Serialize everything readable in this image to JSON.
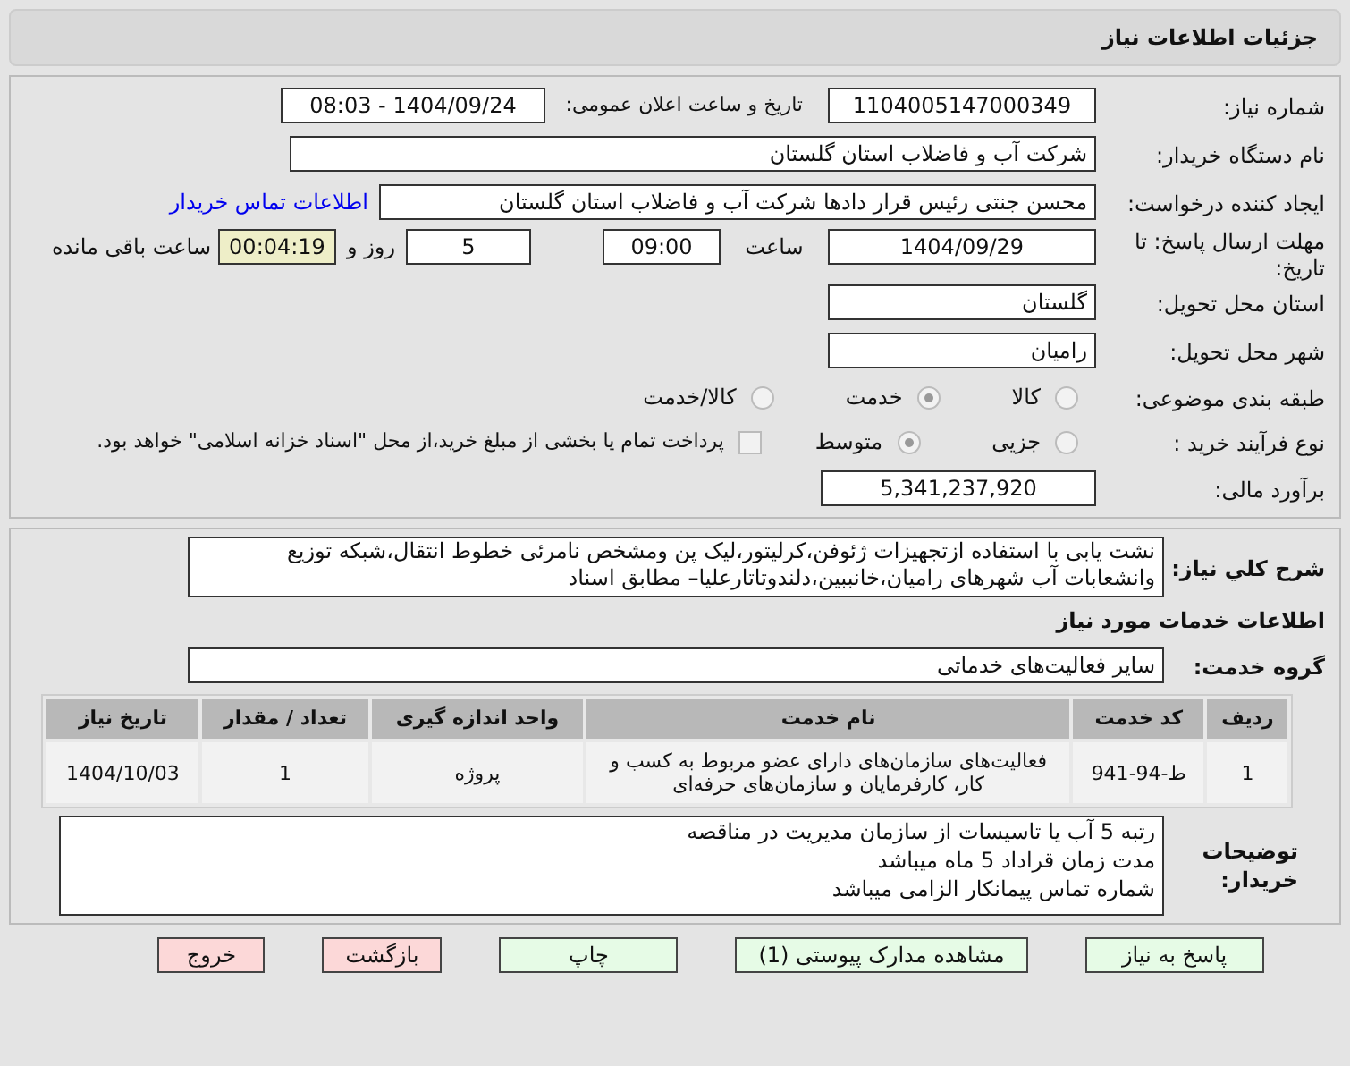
{
  "header": {
    "title": "جزئیات اطلاعات نیاز"
  },
  "need_number": {
    "label": "شماره نیاز:",
    "value": "1104005147000349"
  },
  "announce": {
    "label": "تاریخ و ساعت اعلان عمومی:",
    "value": "1404/09/24 - 08:03"
  },
  "buyer": {
    "label": "نام دستگاه خریدار:",
    "value": "شرکت آب و فاضلاب استان گلستان"
  },
  "creator": {
    "label": "ایجاد کننده درخواست:",
    "value": "محسن جنتی رئیس قرار دادها شرکت آب و فاضلاب استان گلستان",
    "link": "اطلاعات تماس خریدار"
  },
  "deadline": {
    "label": "مهلت ارسال پاسخ: تا تاریخ:",
    "date": "1404/09/29",
    "time_label": "ساعت",
    "time": "09:00",
    "days": "5",
    "days_label": "روز و",
    "remaining": "00:04:19",
    "remaining_label": "ساعت باقی مانده"
  },
  "province": {
    "label": "استان محل تحویل:",
    "value": "گلستان"
  },
  "city": {
    "label": "شهر محل تحویل:",
    "value": "رامیان"
  },
  "category": {
    "label": "طبقه بندی موضوعی:",
    "options": [
      {
        "label": "کالا",
        "selected": false
      },
      {
        "label": "خدمت",
        "selected": true
      },
      {
        "label": "کالا/خدمت",
        "selected": false
      }
    ]
  },
  "process": {
    "label": "نوع فرآیند خرید :",
    "options": [
      {
        "label": "جزیی",
        "selected": false
      },
      {
        "label": "متوسط",
        "selected": true
      }
    ],
    "payment_note": {
      "label": "پرداخت تمام یا بخشی از مبلغ خرید،از محل \"اسناد خزانه اسلامی\" خواهد بود.",
      "checked": false
    }
  },
  "budget": {
    "label": "برآورد مالی:",
    "value": "5,341,237,920"
  },
  "description": {
    "label": "شرح کلي نیاز:",
    "value": "نشت یابی با استفاده ازتجهیزات ژئوفن،کرلیتور،لیک پن ومشخص نامرئی خطوط انتقال،شبکه توزیع وانشعابات آب شهرهای رامیان،خانببین،دلندوتاتارعلیا– مطابق اسناد"
  },
  "services_heading": "اطلاعات خدمات مورد نیاز",
  "service_group": {
    "label": "گروه خدمت:",
    "value": "سایر فعالیت‌های خدماتی"
  },
  "table": {
    "columns": [
      "ردیف",
      "کد خدمت",
      "نام خدمت",
      "واحد اندازه گیری",
      "تعداد / مقدار",
      "تاریخ نیاز"
    ],
    "rows": [
      [
        "1",
        "ط-94-941",
        "فعالیت‌های سازمان‌های دارای عضو مربوط به کسب و کار، کارفرمایان و سازمان‌های حرفه‌ای",
        "پروژه",
        "1",
        "1404/10/03"
      ]
    ]
  },
  "buyer_notes": {
    "label": "توضیحات خریدار:",
    "lines": [
      "رتبه 5 آب یا تاسیسات از سازمان مدیریت در مناقصه",
      "مدت زمان قراداد 5 ماه میباشد",
      "شماره تماس پیمانکار الزامی میباشد"
    ]
  },
  "buttons": [
    {
      "label": "پاسخ به نیاز",
      "kind": "normal"
    },
    {
      "label": "مشاهده مدارک پیوستی (1)",
      "kind": "normal"
    },
    {
      "label": "چاپ",
      "kind": "normal"
    },
    {
      "label": "بازگشت",
      "kind": "danger"
    },
    {
      "label": "خروج",
      "kind": "danger"
    }
  ]
}
